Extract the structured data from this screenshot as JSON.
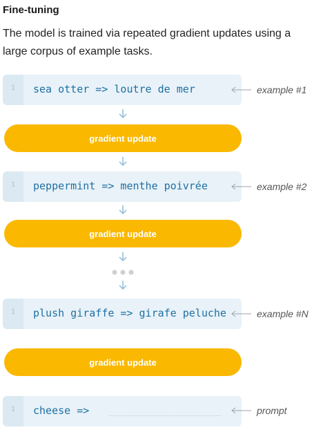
{
  "heading": "Fine-tuning",
  "description": "The model is trained via repeated gradient updates using a large corpus of example tasks.",
  "steps": [
    {
      "line_number": "1",
      "code": "sea otter => loutre de mer",
      "side_label": "example #1"
    },
    {
      "pill_label": "gradient update"
    },
    {
      "line_number": "1",
      "code": "peppermint => menthe poivrée",
      "side_label": "example #2"
    },
    {
      "pill_label": "gradient update"
    },
    {
      "line_number": "1",
      "code": "plush giraffe => girafe peluche",
      "side_label": "example #N"
    },
    {
      "pill_label": "gradient update"
    },
    {
      "line_number": "1",
      "code": "cheese =>",
      "side_label": "prompt"
    }
  ],
  "colors": {
    "pill": "#fbb800",
    "code_text": "#1f6fa3",
    "code_bg": "#e8f2f8",
    "arrow": "#8cbad6"
  },
  "icons": [
    "arrow-down-icon",
    "arrow-left-icon",
    "ellipsis-icon"
  ]
}
